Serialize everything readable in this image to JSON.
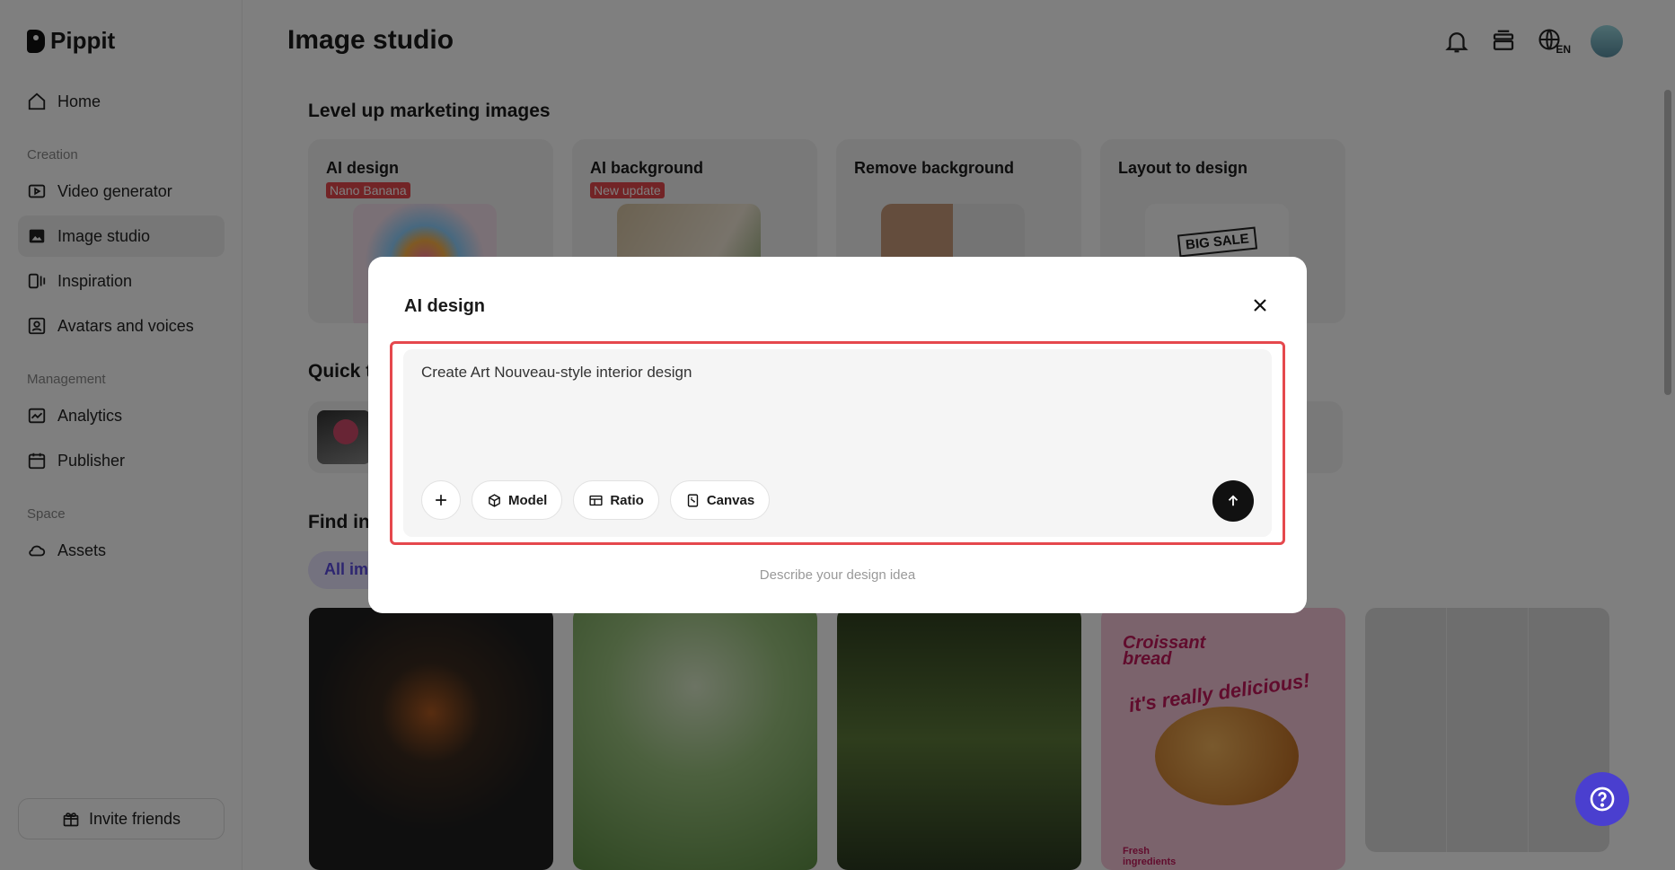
{
  "sidebar": {
    "brand": "Pippit",
    "home": "Home",
    "creation_label": "Creation",
    "video_generator": "Video generator",
    "image_studio": "Image studio",
    "inspiration": "Inspiration",
    "avatars": "Avatars and voices",
    "management_label": "Management",
    "analytics": "Analytics",
    "publisher": "Publisher",
    "space_label": "Space",
    "assets": "Assets",
    "invite": "Invite friends"
  },
  "header": {
    "title": "Image studio",
    "lang_code": "EN"
  },
  "sections": {
    "level_up": "Level up marketing images",
    "quick": "Quick t",
    "find": "Find ins"
  },
  "feature_cards": [
    {
      "title": "AI design",
      "badge": "Nano Banana"
    },
    {
      "title": "AI background",
      "badge": "New update"
    },
    {
      "title": "Remove background"
    },
    {
      "title": "Layout to design",
      "thumb_text": "BIG SALE"
    }
  ],
  "filter": {
    "active": "All ima"
  },
  "gallery": {
    "croissant_title": "Croissant bread",
    "croissant_slogan": "it's really delicious!",
    "croissant_footer": "Fresh ingredients"
  },
  "modal": {
    "title": "AI design",
    "prompt": "Create Art Nouveau-style interior design",
    "model": "Model",
    "ratio": "Ratio",
    "canvas": "Canvas",
    "hint": "Describe your design idea"
  },
  "colors": {
    "accent": "#4a3fcf",
    "highlight_border": "#e5484d",
    "badge": "#e5484d"
  }
}
